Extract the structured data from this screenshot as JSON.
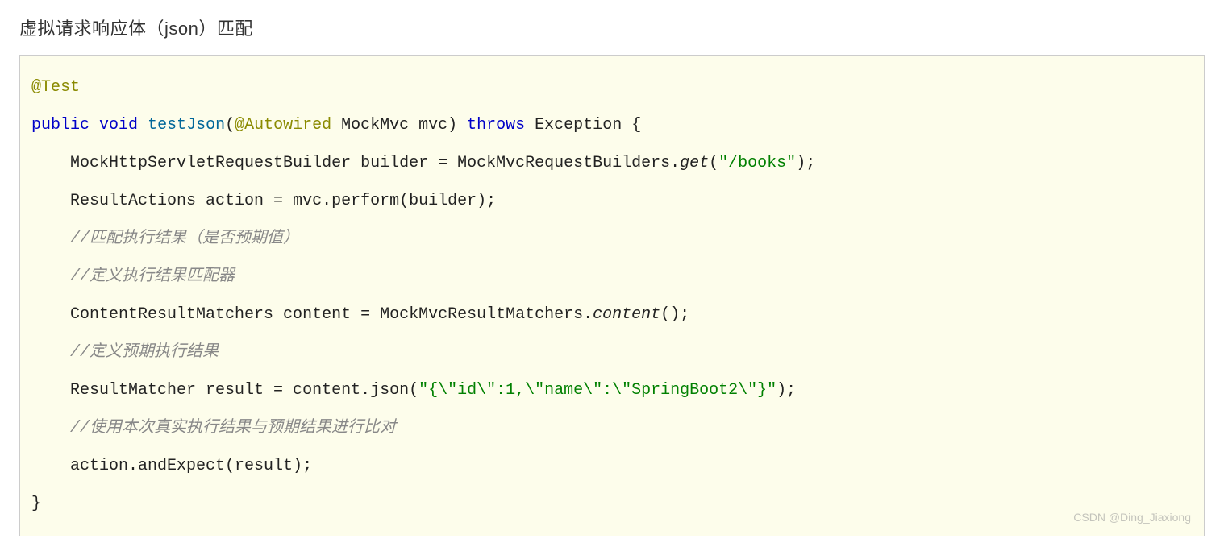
{
  "heading": "虚拟请求响应体（json）匹配",
  "code": {
    "line1": {
      "annotation": "@Test"
    },
    "line2": {
      "kw_public": "public",
      "kw_void": "void",
      "method_name": "testJson",
      "paren_open": "(",
      "annotation": "@Autowired",
      "param": " MockMvc mvc) ",
      "kw_throws": "throws",
      "tail": " Exception {"
    },
    "line3": {
      "indent": "    ",
      "pre": "MockHttpServletRequestBuilder builder = MockMvcRequestBuilders.",
      "italic": "get",
      "paren": "(",
      "str": "\"/books\"",
      "tail": ");"
    },
    "line4": {
      "indent": "    ",
      "text": "ResultActions action = mvc.perform(builder);"
    },
    "line5": {
      "indent": "    ",
      "comment": "//匹配执行结果（是否预期值）"
    },
    "line6": {
      "indent": "    ",
      "comment": "//定义执行结果匹配器"
    },
    "line7": {
      "indent": "    ",
      "pre": "ContentResultMatchers content = MockMvcResultMatchers.",
      "italic": "content",
      "tail": "();"
    },
    "line8": {
      "indent": "    ",
      "comment": "//定义预期执行结果"
    },
    "line9": {
      "indent": "    ",
      "pre": "ResultMatcher result = content.json(",
      "str": "\"{\\\"id\\\":1,\\\"name\\\":\\\"SpringBoot2\\\"}\"",
      "tail": ");"
    },
    "line10": {
      "indent": "    ",
      "comment": "//使用本次真实执行结果与预期结果进行比对"
    },
    "line11": {
      "indent": "    ",
      "text": "action.andExpect(result);"
    },
    "line12": {
      "text": "}"
    }
  },
  "watermark": "CSDN @Ding_Jiaxiong"
}
